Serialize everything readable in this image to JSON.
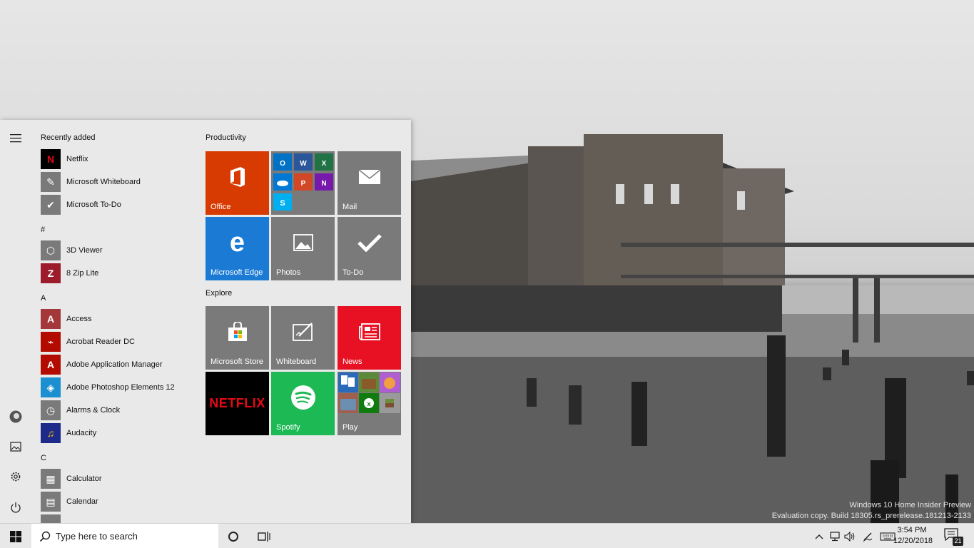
{
  "watermark": {
    "line1": "Windows 10 Home Insider Preview",
    "line2": "Evaluation copy. Build 18305.rs_prerelease.181213-2133"
  },
  "start_menu": {
    "rail": [
      {
        "name": "hamburger-menu-icon"
      },
      {
        "name": "user-avatar"
      },
      {
        "name": "pictures-icon"
      },
      {
        "name": "settings-gear-icon"
      },
      {
        "name": "power-icon"
      }
    ],
    "app_list": {
      "recently_added_header": "Recently added",
      "hash_header": "#",
      "a_header": "A",
      "c_header": "C",
      "apps": [
        {
          "label": "Netflix",
          "color": "#000000",
          "glyph": "N",
          "glyph_color": "#e50914"
        },
        {
          "label": "Microsoft Whiteboard",
          "color": "#7a7a7a",
          "glyph": "✎",
          "glyph_color": "#ffffff"
        },
        {
          "label": "Microsoft To-Do",
          "color": "#7a7a7a",
          "glyph": "✔",
          "glyph_color": "#ffffff"
        },
        {
          "label": "3D Viewer",
          "color": "#7a7a7a",
          "glyph": "⬡",
          "glyph_color": "#ffffff"
        },
        {
          "label": "8 Zip Lite",
          "color": "#9c1c2c",
          "glyph": "Z",
          "glyph_color": "#ffffff"
        },
        {
          "label": "Access",
          "color": "#a4373a",
          "glyph": "A",
          "glyph_color": "#ffffff"
        },
        {
          "label": "Acrobat Reader DC",
          "color": "#b30b00",
          "glyph": "⌁",
          "glyph_color": "#ffffff"
        },
        {
          "label": "Adobe Application Manager",
          "color": "#b30b00",
          "glyph": "A",
          "glyph_color": "#ffffff"
        },
        {
          "label": "Adobe Photoshop Elements 12",
          "color": "#1c8fd1",
          "glyph": "◈",
          "glyph_color": "#ffffff"
        },
        {
          "label": "Alarms & Clock",
          "color": "#7a7a7a",
          "glyph": "◷",
          "glyph_color": "#ffffff"
        },
        {
          "label": "Audacity",
          "color": "#1d2a8a",
          "glyph": "♫",
          "glyph_color": "#f6c200"
        },
        {
          "label": "Calculator",
          "color": "#7a7a7a",
          "glyph": "▦",
          "glyph_color": "#ffffff"
        },
        {
          "label": "Calendar",
          "color": "#7a7a7a",
          "glyph": "▤",
          "glyph_color": "#ffffff"
        }
      ]
    },
    "tiles": {
      "productivity_header": "Productivity",
      "explore_header": "Explore",
      "office": {
        "label": "Office",
        "color": "#d83b01"
      },
      "office_apps": {
        "color": "#7a7a7a"
      },
      "mail": {
        "label": "Mail",
        "color": "#7a7a7a"
      },
      "edge": {
        "label": "Microsoft Edge",
        "color": "#1a7ad4"
      },
      "photos": {
        "label": "Photos",
        "color": "#7a7a7a"
      },
      "todo": {
        "label": "To-Do",
        "color": "#7a7a7a"
      },
      "store": {
        "label": "Microsoft Store",
        "color": "#7a7a7a"
      },
      "whiteboard": {
        "label": "Whiteboard",
        "color": "#7a7a7a"
      },
      "news": {
        "label": "News",
        "color": "#e81123"
      },
      "netflix": {
        "label": "NETFLIX",
        "color": "#000000",
        "accent": "#e50914"
      },
      "spotify": {
        "label": "Spotify",
        "color": "#1db954"
      },
      "play": {
        "label": "Play",
        "color": "#7a7a7a"
      }
    }
  },
  "taskbar": {
    "search_placeholder": "Type here to search",
    "time": "3:54 PM",
    "date": "12/20/2018",
    "notification_count": "21"
  }
}
